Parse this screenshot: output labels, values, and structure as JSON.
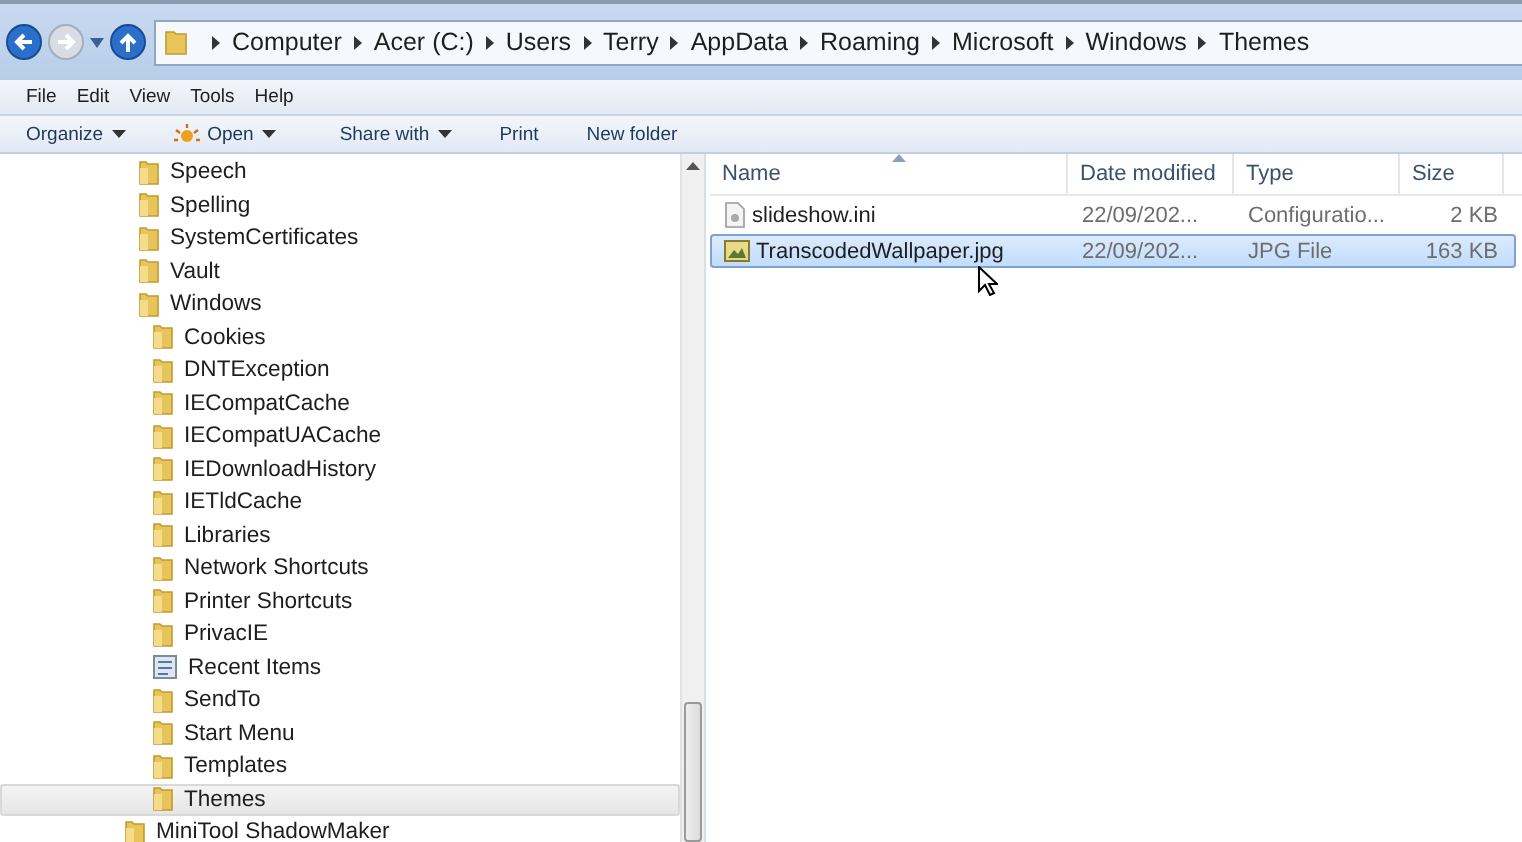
{
  "address_bar": {
    "path": [
      "Computer",
      "Acer (C:)",
      "Users",
      "Terry",
      "AppData",
      "Roaming",
      "Microsoft",
      "Windows",
      "Themes"
    ]
  },
  "menu_bar": [
    "File",
    "Edit",
    "View",
    "Tools",
    "Help"
  ],
  "command_bar": [
    {
      "label": "Organize",
      "kind": "dropdown"
    },
    {
      "label": "Open",
      "kind": "open"
    },
    {
      "label": "Share with",
      "kind": "dropdown"
    },
    {
      "label": "Print",
      "kind": "plain"
    },
    {
      "label": "New folder",
      "kind": "plain"
    }
  ],
  "tree": {
    "nested_items": [
      {
        "label": "Speech",
        "kind": "folder",
        "selected": false
      },
      {
        "label": "Spelling",
        "kind": "folder",
        "selected": false
      },
      {
        "label": "SystemCertificates",
        "kind": "folder",
        "selected": false
      },
      {
        "label": "Vault",
        "kind": "folder",
        "selected": false
      },
      {
        "label": "Windows",
        "kind": "folder",
        "selected": false,
        "children": [
          {
            "label": "Cookies",
            "kind": "folder",
            "selected": false
          },
          {
            "label": "DNTException",
            "kind": "folder",
            "selected": false
          },
          {
            "label": "IECompatCache",
            "kind": "folder",
            "selected": false
          },
          {
            "label": "IECompatUACache",
            "kind": "folder",
            "selected": false
          },
          {
            "label": "IEDownloadHistory",
            "kind": "folder",
            "selected": false
          },
          {
            "label": "IETldCache",
            "kind": "folder",
            "selected": false
          },
          {
            "label": "Libraries",
            "kind": "folder",
            "selected": false
          },
          {
            "label": "Network Shortcuts",
            "kind": "folder",
            "selected": false
          },
          {
            "label": "Printer Shortcuts",
            "kind": "folder",
            "selected": false
          },
          {
            "label": "PrivacIE",
            "kind": "folder",
            "selected": false
          },
          {
            "label": "Recent Items",
            "kind": "recent",
            "selected": false
          },
          {
            "label": "SendTo",
            "kind": "folder",
            "selected": false
          },
          {
            "label": "Start Menu",
            "kind": "folder",
            "selected": false
          },
          {
            "label": "Templates",
            "kind": "folder",
            "selected": false
          },
          {
            "label": "Themes",
            "kind": "folder",
            "selected": true
          }
        ]
      }
    ],
    "items": [
      {
        "label": "MiniTool ShadowMaker",
        "kind": "folder",
        "selected": false
      }
    ]
  },
  "file_list": {
    "columns": [
      "Name",
      "Date modified",
      "Type",
      "Size"
    ],
    "rows": [
      {
        "name": "slideshow.ini",
        "kind": "settings",
        "date": "22/09/202...",
        "type": "Configuratio...",
        "size": "2 KB",
        "selected": false
      },
      {
        "name": "TranscodedWallpaper.jpg",
        "kind": "image",
        "date": "22/09/202...",
        "type": "JPG File",
        "size": "163 KB",
        "selected": true
      }
    ]
  }
}
